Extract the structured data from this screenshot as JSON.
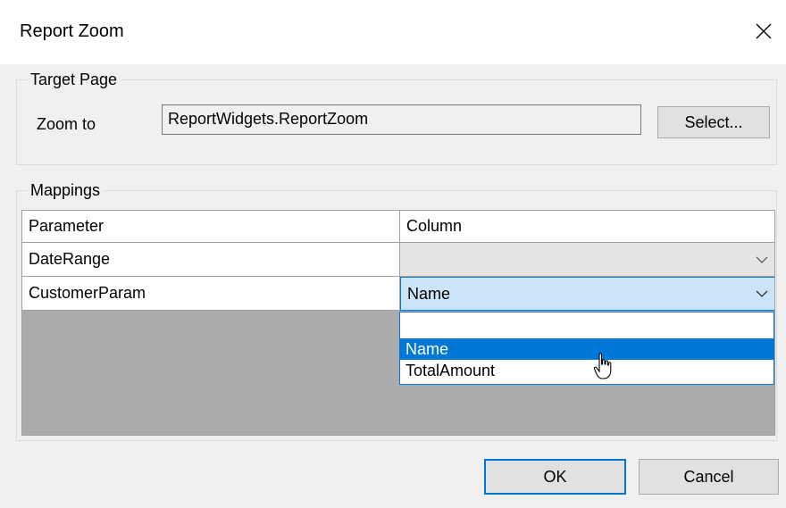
{
  "dialog": {
    "title": "Report Zoom",
    "close_icon": "close-icon"
  },
  "target_page": {
    "legend": "Target Page",
    "zoom_to_label": "Zoom to",
    "zoom_to_value": "ReportWidgets.ReportZoom",
    "select_button": "Select..."
  },
  "mappings": {
    "legend": "Mappings",
    "columns": [
      "Parameter",
      "Column"
    ],
    "rows": [
      {
        "parameter": "DateRange",
        "column": ""
      },
      {
        "parameter": "CustomerParam",
        "column": "Name"
      }
    ],
    "dropdown_options": [
      "",
      "Name",
      "TotalAmount"
    ],
    "dropdown_selected": "Name"
  },
  "buttons": {
    "ok": "OK",
    "cancel": "Cancel"
  },
  "colors": {
    "accent": "#0078d7",
    "selected_cell": "#cce4f7",
    "grid_empty": "#ababab",
    "dialog_bg": "#f0f0f0"
  }
}
